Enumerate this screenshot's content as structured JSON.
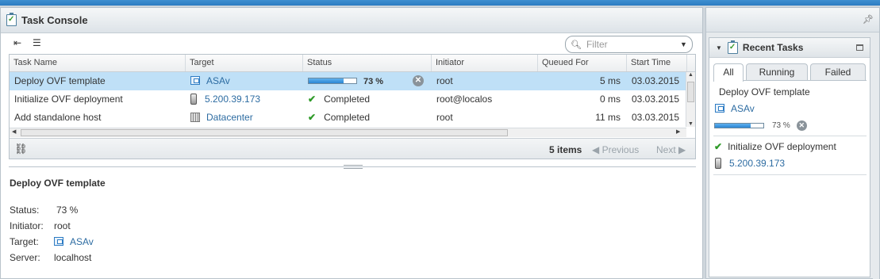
{
  "task_console": {
    "title": "Task Console",
    "filter_placeholder": "Filter",
    "columns": [
      "Task Name",
      "Target",
      "Status",
      "Initiator",
      "Queued For",
      "Start Time"
    ],
    "rows": [
      {
        "task": "Deploy OVF template",
        "target": "ASAv",
        "target_icon": "vm-icon",
        "status": "73 %",
        "progress": 0.73,
        "initiator": "root",
        "queued": "5 ms",
        "start": "03.03.2015",
        "selected": true
      },
      {
        "task": "Initialize OVF deployment",
        "target": "5.200.39.173",
        "target_icon": "host-icon",
        "status": "Completed",
        "initiator": "root@localos",
        "queued": "0 ms",
        "start": "03.03.2015",
        "selected": false
      },
      {
        "task": "Add standalone host",
        "target": "Datacenter",
        "target_icon": "datacenter-icon",
        "status": "Completed",
        "initiator": "root",
        "queued": "11 ms",
        "start": "03.03.2015",
        "selected": false
      }
    ],
    "footer": {
      "items_count": "5 items",
      "previous": "Previous",
      "next": "Next"
    }
  },
  "details": {
    "title": "Deploy OVF template",
    "status_label": "Status:",
    "status_value": "73 %",
    "initiator_label": "Initiator:",
    "initiator_value": "root",
    "target_label": "Target:",
    "target_value": "ASAv",
    "server_label": "Server:",
    "server_value": "localhost"
  },
  "recent_tasks": {
    "title": "Recent Tasks",
    "tabs": [
      "All",
      "Running",
      "Failed"
    ],
    "active_tab": "All",
    "items": [
      {
        "name": "Deploy OVF template",
        "target": "ASAv",
        "percent": "73 %",
        "progress": 0.73
      },
      {
        "name": "Initialize OVF deployment",
        "target": "5.200.39.173"
      }
    ]
  },
  "colors": {
    "selected_row": "#bfe0f7",
    "link": "#2d6ca2",
    "success": "#2e9a28",
    "accent": "#2b86d4"
  }
}
